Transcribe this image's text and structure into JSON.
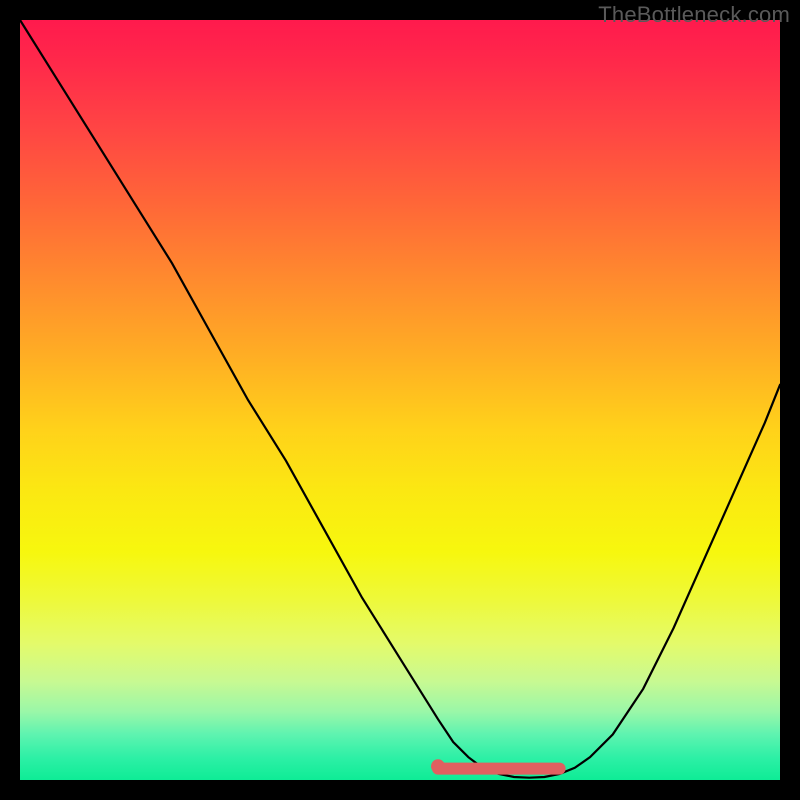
{
  "watermark": "TheBottleneck.com",
  "colors": {
    "curve": "#000000",
    "marker": "#e06060",
    "frame": "#000000"
  },
  "chart_data": {
    "type": "line",
    "title": "",
    "xlabel": "",
    "ylabel": "",
    "xlim": [
      0,
      100
    ],
    "ylim": [
      0,
      100
    ],
    "grid": false,
    "legend": false,
    "series": [
      {
        "name": "bottleneck-curve",
        "x": [
          0,
          5,
          10,
          15,
          20,
          25,
          30,
          35,
          40,
          45,
          50,
          55,
          57,
          59,
          61,
          63,
          65,
          67,
          69,
          71,
          73,
          75,
          78,
          82,
          86,
          90,
          94,
          98,
          100
        ],
        "y": [
          100,
          92,
          84,
          76,
          68,
          59,
          50,
          42,
          33,
          24,
          16,
          8,
          5,
          3,
          1.5,
          0.8,
          0.4,
          0.3,
          0.4,
          0.8,
          1.6,
          3,
          6,
          12,
          20,
          29,
          38,
          47,
          52
        ]
      }
    ],
    "annotations": [
      {
        "name": "optimal-range-marker",
        "type": "segment",
        "x": [
          55,
          71
        ],
        "y": [
          1.5,
          1.5
        ]
      },
      {
        "name": "optimal-range-start-dot",
        "type": "point",
        "x": 55,
        "y": 1.8
      }
    ]
  }
}
